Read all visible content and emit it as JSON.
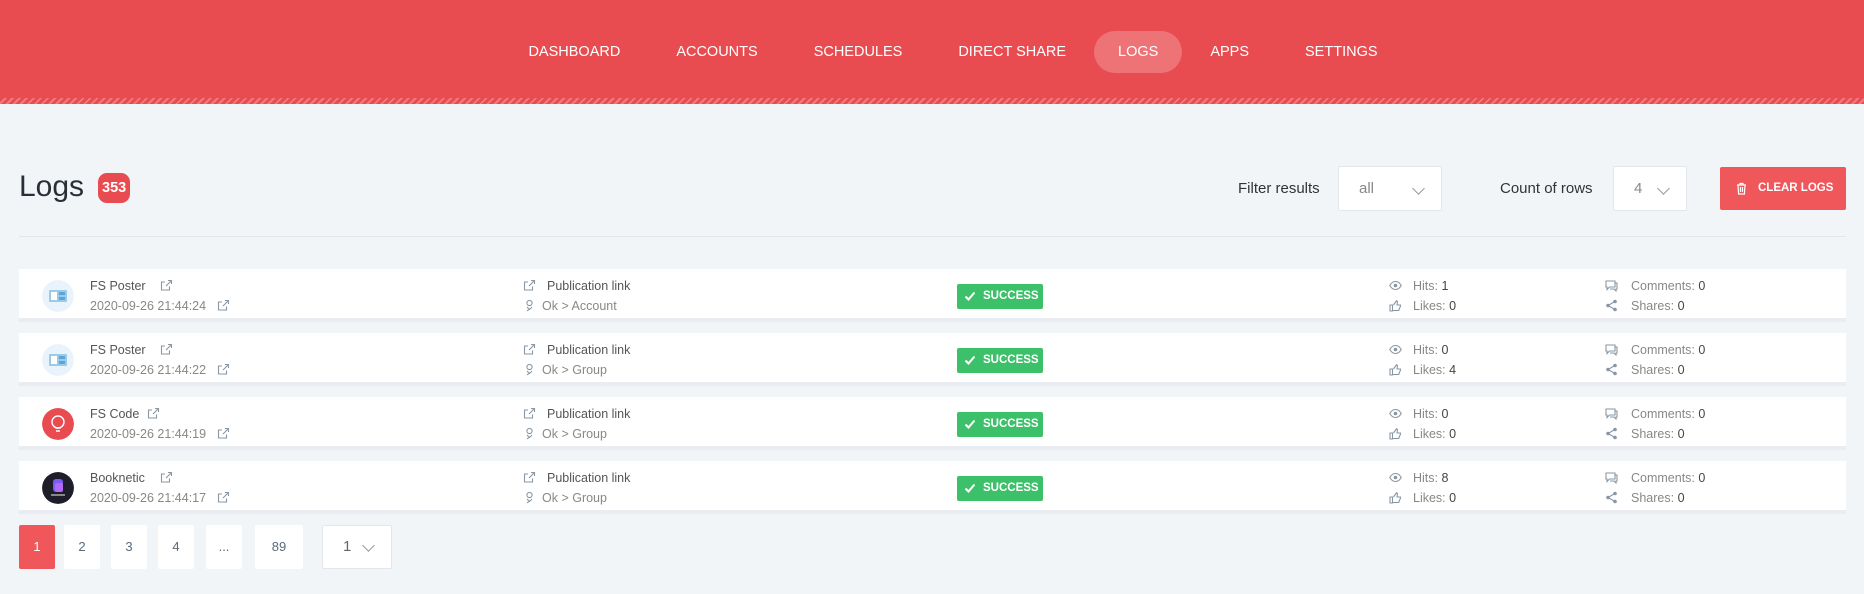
{
  "nav": {
    "items": [
      {
        "label": "DASHBOARD"
      },
      {
        "label": "ACCOUNTS"
      },
      {
        "label": "SCHEDULES"
      },
      {
        "label": "DIRECT SHARE"
      },
      {
        "label": "LOGS"
      },
      {
        "label": "APPS"
      },
      {
        "label": "SETTINGS"
      }
    ],
    "active": "LOGS"
  },
  "page": {
    "title": "Logs",
    "count": "353"
  },
  "filter": {
    "label": "Filter results",
    "value": "all"
  },
  "rows_count": {
    "label": "Count of rows",
    "value": "4"
  },
  "clear_button": {
    "label": "CLEAR LOGS"
  },
  "colors": {
    "accent": "#e84c50",
    "success": "#3cc16a",
    "background": "#f1f5f8"
  },
  "logs": [
    {
      "name": "FS Poster",
      "date": "2020-09-26 21:44:24",
      "link": "Publication link",
      "target": "Ok > Account",
      "status": "SUCCESS",
      "hits_label": "Hits:",
      "hits": "1",
      "likes_label": "Likes:",
      "likes": "0",
      "comments_label": "Comments:",
      "comments": "0",
      "shares_label": "Shares:",
      "shares": "0",
      "avatar": "fs-poster-avatar"
    },
    {
      "name": "FS Poster",
      "date": "2020-09-26 21:44:22",
      "link": "Publication link",
      "target": "Ok > Group",
      "status": "SUCCESS",
      "hits_label": "Hits:",
      "hits": "0",
      "likes_label": "Likes:",
      "likes": "4",
      "comments_label": "Comments:",
      "comments": "0",
      "shares_label": "Shares:",
      "shares": "0",
      "avatar": "fs-poster-avatar"
    },
    {
      "name": "FS Code",
      "date": "2020-09-26 21:44:19",
      "link": "Publication link",
      "target": "Ok > Group",
      "status": "SUCCESS",
      "hits_label": "Hits:",
      "hits": "0",
      "likes_label": "Likes:",
      "likes": "0",
      "comments_label": "Comments:",
      "comments": "0",
      "shares_label": "Shares:",
      "shares": "0",
      "avatar": "fs-code-avatar"
    },
    {
      "name": "Booknetic",
      "date": "2020-09-26 21:44:17",
      "link": "Publication link",
      "target": "Ok > Group",
      "status": "SUCCESS",
      "hits_label": "Hits:",
      "hits": "8",
      "likes_label": "Likes:",
      "likes": "0",
      "comments_label": "Comments:",
      "comments": "0",
      "shares_label": "Shares:",
      "shares": "0",
      "avatar": "booknetic-avatar"
    }
  ],
  "pagination": {
    "pages": [
      "1",
      "2",
      "3",
      "4",
      "...",
      "89"
    ],
    "current": "1",
    "jump_value": "1"
  }
}
